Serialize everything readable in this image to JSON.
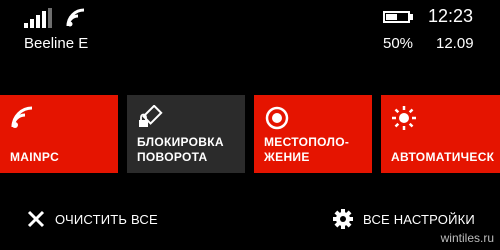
{
  "status_bar": {
    "carrier": "Beeline E",
    "battery_percent": "50%",
    "battery_level": 0.5,
    "time": "12:23",
    "date": "12.09"
  },
  "quick_actions": [
    {
      "label": "MAINPC",
      "icon": "wifi-icon",
      "color": "#e51400"
    },
    {
      "label": "БЛОКИРОВКА\nПОВОРОТА",
      "icon": "rotation-lock-icon",
      "color": "#2b2b2b"
    },
    {
      "label": "МЕСТОПОЛО-\nЖЕНИЕ",
      "icon": "location-icon",
      "color": "#e51400"
    },
    {
      "label": "АВТОМАТИЧЕСК",
      "icon": "brightness-icon",
      "color": "#e51400"
    }
  ],
  "actions": {
    "clear_all": "ОЧИСТИТЬ ВСЕ",
    "all_settings": "ВСЕ НАСТРОЙКИ"
  },
  "watermark": "wintiles.ru"
}
